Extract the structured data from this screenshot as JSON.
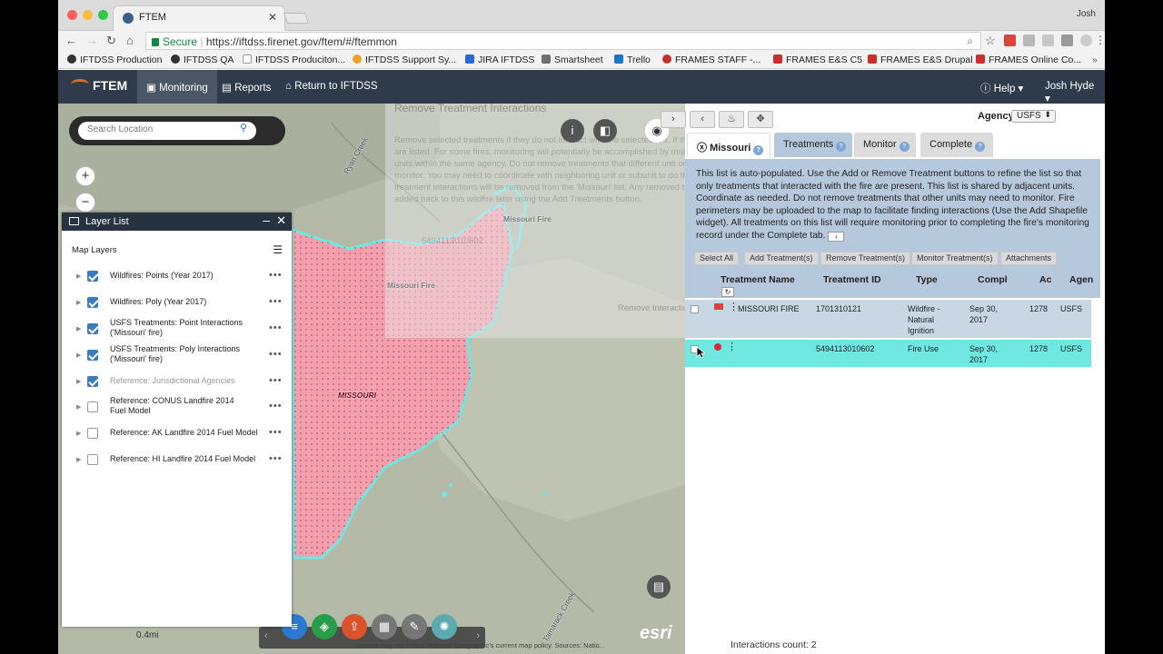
{
  "browser": {
    "tab_title": "FTEM",
    "user": "Josh",
    "secure_label": "Secure",
    "url": "https://iftdss.firenet.gov/ftem/#/ftemmon"
  },
  "bookmarks": [
    "IFTDSS Production",
    "IFTDSS QA",
    "IFTDSS Produciton...",
    "IFTDSS Support Sy...",
    "JIRA IFTDSS",
    "Smartsheet",
    "Trello",
    "FRAMES STAFF -...",
    "FRAMES E&S C5",
    "FRAMES E&S Drupal",
    "FRAMES Online Co..."
  ],
  "app": {
    "logo": "FTEM",
    "nav": [
      "Monitoring",
      "Reports",
      "Return to IFTDSS"
    ],
    "help": "Help",
    "user": "Josh Hyde"
  },
  "map": {
    "search_placeholder": "Search Location",
    "zoom_in": "+",
    "zoom_out": "−",
    "labels": {
      "fire_point_1": "Missouri Fire",
      "fire_point_2": "Missouri Fire",
      "fire_poly": "MISSOURI",
      "creek_1": "Ryan Creek",
      "creek_2": "Tamarack Creek"
    },
    "scale": "0.4mi",
    "attribution": "content may not reflect National Geographic's current map policy. Sources: Natio...",
    "esri": "esri"
  },
  "layer_list": {
    "title": "Layer List",
    "section": "Map Layers",
    "layers": [
      {
        "label": "Wildfires: Points (Year 2017)",
        "checked": true
      },
      {
        "label": "Wildfires: Poly (Year 2017)",
        "checked": true
      },
      {
        "label": "USFS Treatments: Point Interactions ('Missouri' fire)",
        "checked": true
      },
      {
        "label": "USFS Treatments: Poly Interactions ('Missouri' fire)",
        "checked": true
      },
      {
        "label": "Reference: Jurisdictional Agencies",
        "checked": true
      },
      {
        "label": "Reference: CONUS Landfire 2014 Fuel Model",
        "checked": false
      },
      {
        "label": "Reference: AK Landfire 2014 Fuel Model",
        "checked": false
      },
      {
        "label": "Reference: HI Landfire 2014 Fuel Model",
        "checked": false
      }
    ]
  },
  "overlay": {
    "title": "Remove Treatment Interactions",
    "text": "Remove selected treatments if they do not interact with the selected fire. If the same treatment are listed. For some fires, monitoring will potentially be accomplished by multiple neighboring units within the same agency. Do not remove treatments that different unit or subunit may need to monitor. You may need to coordinate with neighboring unit or subunit to do this list. The following treatment interactions will be removed from the 'Missouri' list. Any removed treatments can be added back to this wildfire later using the Add Treatments button.",
    "item": "5494113010602",
    "remove_button": "Remove Interactions"
  },
  "panel": {
    "agency_label": "Agency",
    "agency_value": "USFS",
    "tabs": [
      {
        "label": "Missouri",
        "badge": "?"
      },
      {
        "label": "Treatments",
        "badge": "?"
      },
      {
        "label": "Monitor",
        "badge": "?"
      },
      {
        "label": "Complete",
        "badge": "?"
      }
    ],
    "info": "This list is auto-populated. Use the Add or Remove Treatment buttons to refine the list so that only treatments that interacted with the fire are present. This list is shared by adjacent units. Coordinate as needed. Do not remove treatments that other units may need to monitor. Fire perimeters may be uploaded to the map to facilitate finding interactions (Use the Add Shapefile widget). All treatments on this list will require monitoring prior to completing the fire's monitoring record under the Complete tab.",
    "buttons": [
      "Select All",
      "Add Treatment(s)",
      "Remove Treatment(s)",
      "Monitor Treatment(s)",
      "Attachments"
    ],
    "columns": [
      "Treatment Name",
      "Treatment ID",
      "Type",
      "Compl",
      "Ac",
      "Agen"
    ],
    "rows": [
      {
        "name": "MISSOURI FIRE",
        "id": "1701310121",
        "type": "Wildfire - Natural Ignition",
        "compl": "Sep 30, 2017",
        "ac": "1278",
        "agency": "USFS"
      },
      {
        "name": "",
        "id": "5494113010602",
        "type": "Fire Use",
        "compl": "Sep 30, 2017",
        "ac": "1278",
        "agency": "USFS"
      }
    ],
    "count": "Interactions count: 2"
  },
  "colors": {
    "accent": "#2f3b4a",
    "fire": "#f2a0ae",
    "treatment": "#6fe8e2",
    "highlight": "#6fe8e2",
    "info_bg": "#b6c8dc"
  }
}
